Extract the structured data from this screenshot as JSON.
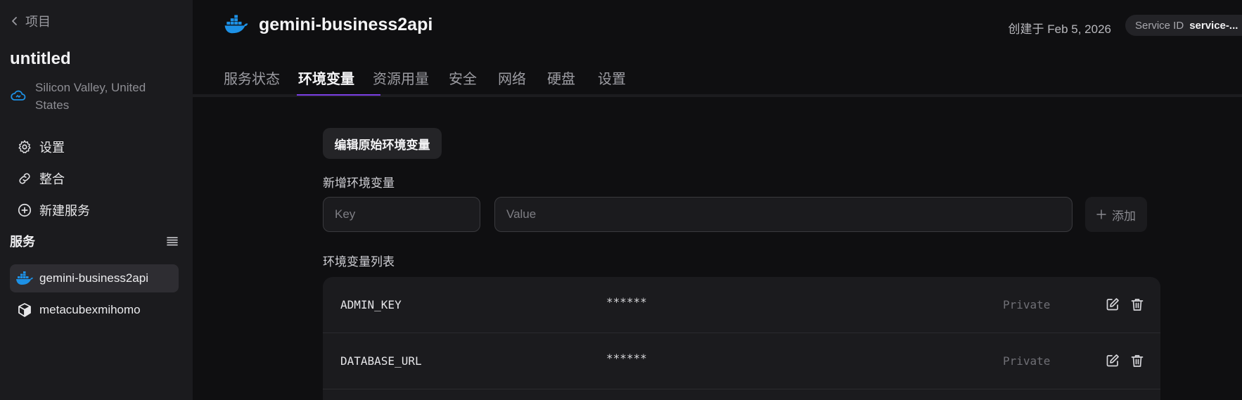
{
  "sidebar": {
    "back_label": "项目",
    "project_title": "untitled",
    "region": "Silicon Valley, United States",
    "nav": [
      {
        "label": "设置",
        "icon": "gear-icon"
      },
      {
        "label": "整合",
        "icon": "link-icon"
      },
      {
        "label": "新建服务",
        "icon": "plus-circle-icon"
      }
    ],
    "services_heading": "服务",
    "services": [
      {
        "name": "gemini-business2api",
        "icon": "docker-icon",
        "active": true
      },
      {
        "name": "metacubexmihomo",
        "icon": "cube-icon",
        "active": false
      }
    ]
  },
  "header": {
    "service_name": "gemini-business2api",
    "created": "创建于 Feb 5, 2026",
    "service_id_label": "Service ID",
    "service_id_value": "service-..."
  },
  "tabs": [
    {
      "label": "服务状态",
      "active": false
    },
    {
      "label": "环境变量",
      "active": true
    },
    {
      "label": "资源用量",
      "active": false
    },
    {
      "label": "安全",
      "active": false
    },
    {
      "label": "网络",
      "active": false
    },
    {
      "label": "硬盘",
      "active": false
    },
    {
      "label": "设置",
      "active": false
    }
  ],
  "env": {
    "edit_raw_label": "编辑原始环境变量",
    "add_heading": "新增环境变量",
    "key_placeholder": "Key",
    "value_placeholder": "Value",
    "add_label": "添加",
    "list_heading": "环境变量列表",
    "rows": [
      {
        "key": "ADMIN_KEY",
        "value": "******",
        "visibility": "Private"
      },
      {
        "key": "DATABASE_URL",
        "value": "******",
        "visibility": "Private"
      }
    ]
  },
  "colors": {
    "accent": "#7b3fe4",
    "docker_blue": "#1d91e6",
    "background": "#0f0f11",
    "sidebar": "#1b1b1e"
  }
}
